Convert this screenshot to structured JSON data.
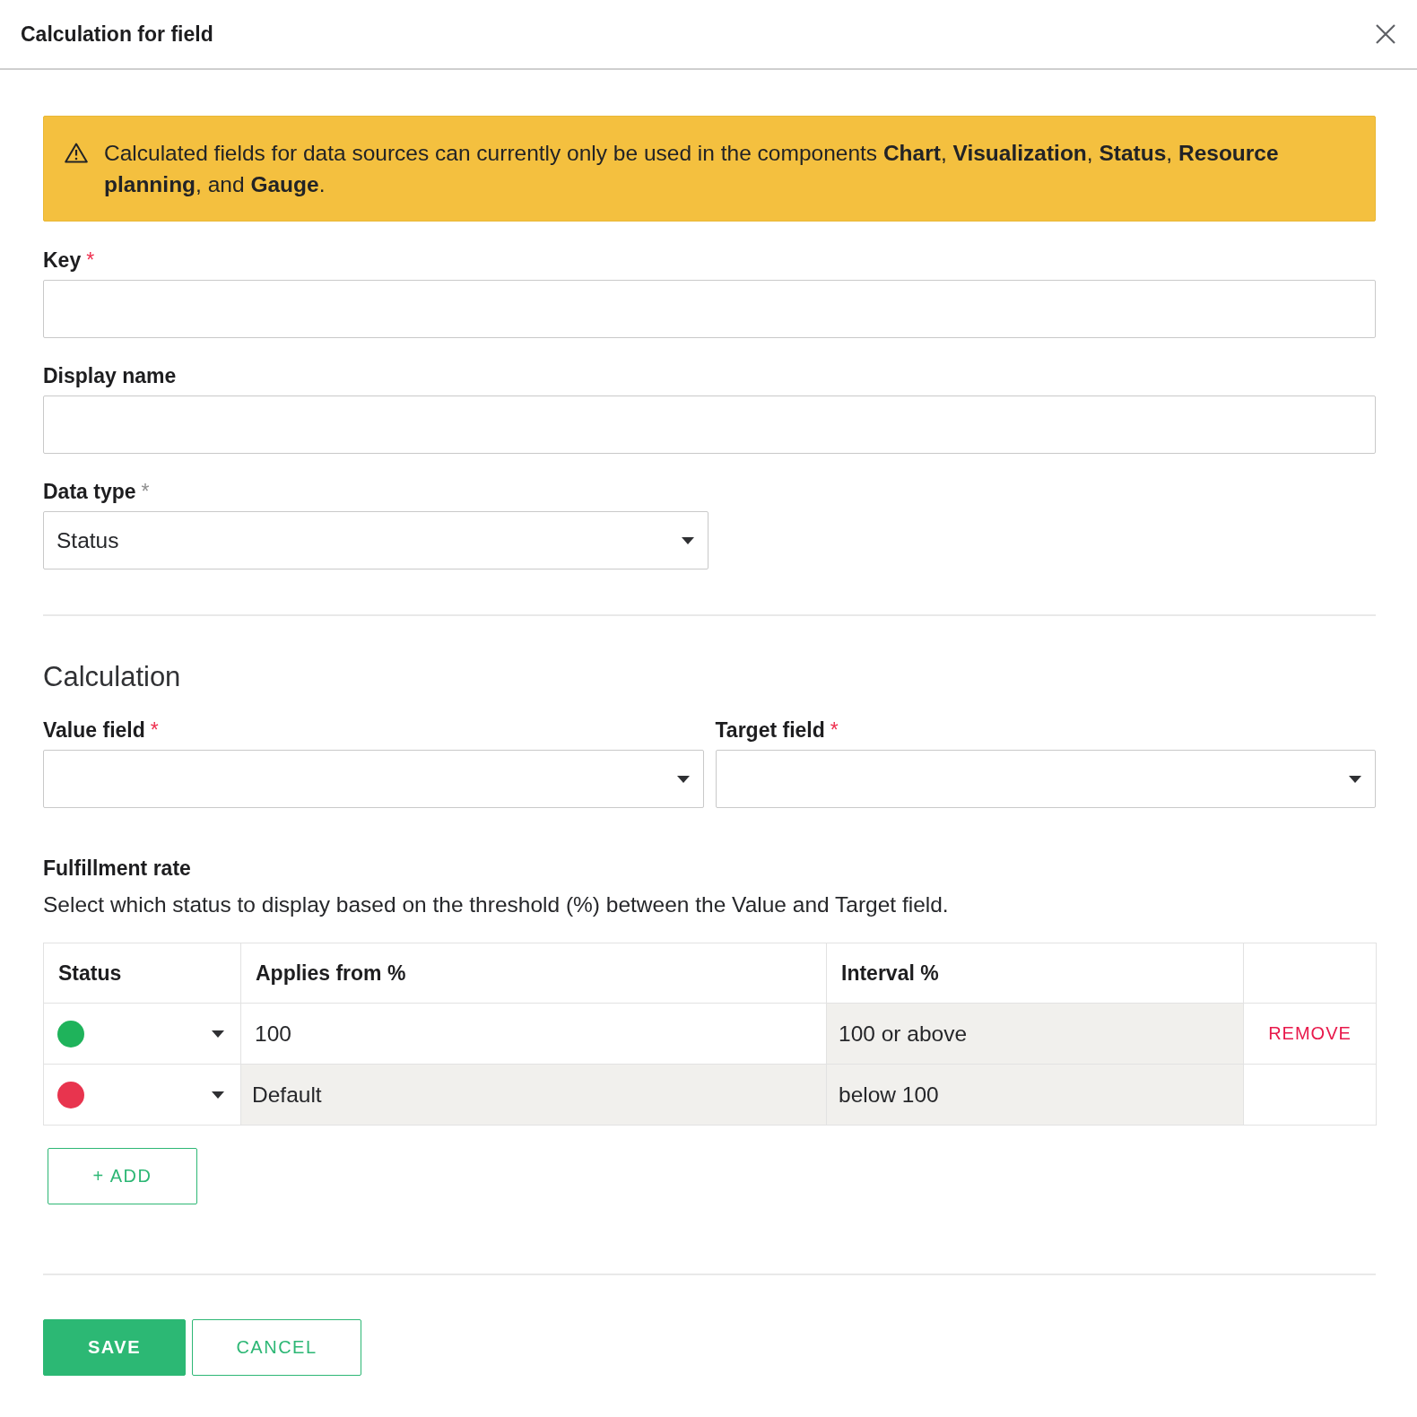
{
  "dialog": {
    "title": "Calculation for field"
  },
  "notice": {
    "text": "Calculated fields for data sources can currently only be used in the components **Chart**, **Visualization**, **Status**, **Resource planning**, and **Gauge**."
  },
  "fields": [
    {
      "kind": "text",
      "label": "Key",
      "required_mark": {
        "text": "*",
        "color": "#ee3150"
      }
    },
    {
      "kind": "text",
      "label": "Display name"
    },
    {
      "kind": "select",
      "label": "Data type",
      "value": "Status",
      "required_mark": {
        "text": "*",
        "color": "#8f8f8f"
      }
    }
  ],
  "calculation": {
    "heading": "Calculation",
    "fields": [
      {
        "kind": "select",
        "label": "Value field",
        "required_mark": {
          "text": "*",
          "color": "#ee3150"
        }
      },
      {
        "kind": "select",
        "label": "Target field",
        "required_mark": {
          "text": "*",
          "color": "#ee3150"
        }
      }
    ]
  },
  "fulfillment": {
    "title": "Fulfillment rate",
    "description": "Select which status to display based on the threshold (%) between the Value and Target field.",
    "table": {
      "columns": [
        "Status",
        "Applies from %",
        "Interval %"
      ],
      "rows": [
        {
          "color": "#1fb35b",
          "applies_from": {
            "value": "100",
            "disabled": false
          },
          "interval": "100 or above",
          "action": "REMOVE"
        },
        {
          "color": "#e8344e",
          "applies_from": {
            "value": "Default",
            "disabled": true
          },
          "interval": "below 100"
        }
      ]
    },
    "add_button": "+ ADD"
  },
  "buttons": [
    {
      "kind": "primary",
      "label": "SAVE"
    },
    {
      "kind": "secondary",
      "label": "CANCEL"
    }
  ]
}
